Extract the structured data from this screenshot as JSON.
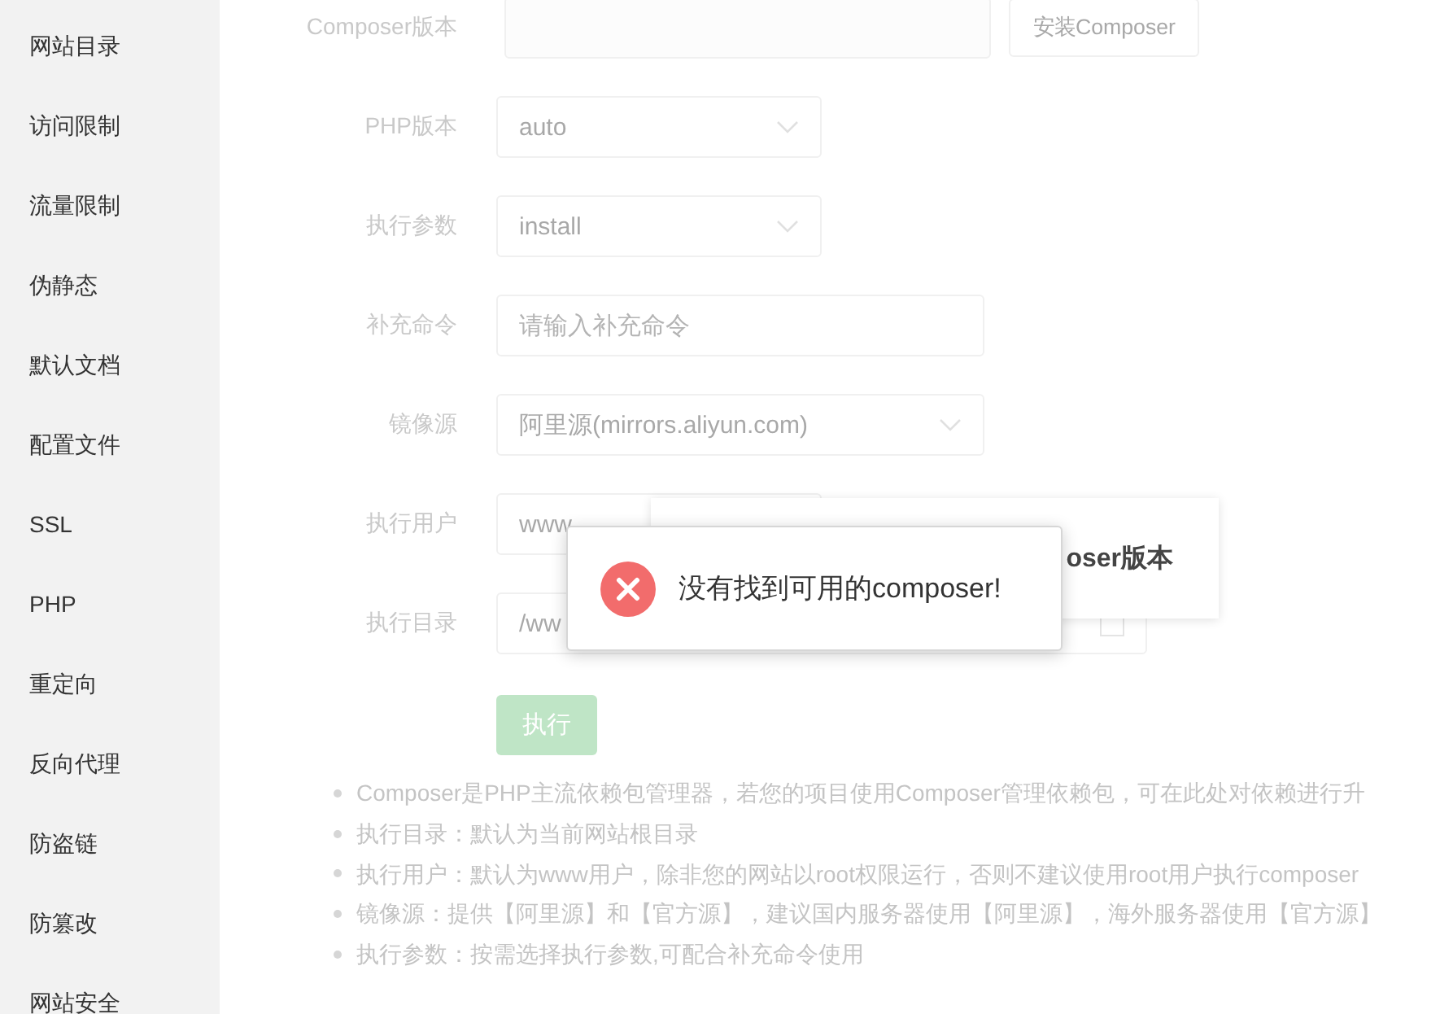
{
  "sidebar": {
    "items": [
      {
        "label": "网站目录"
      },
      {
        "label": "访问限制"
      },
      {
        "label": "流量限制"
      },
      {
        "label": "伪静态"
      },
      {
        "label": "默认文档"
      },
      {
        "label": "配置文件"
      },
      {
        "label": "SSL"
      },
      {
        "label": "PHP"
      },
      {
        "label": "重定向"
      },
      {
        "label": "反向代理"
      },
      {
        "label": "防盗链"
      },
      {
        "label": "防篡改"
      },
      {
        "label": "网站安全"
      }
    ]
  },
  "form": {
    "rows": [
      {
        "kind": "readonly",
        "label": "Composer版本",
        "button": "安装Composer"
      },
      {
        "kind": "select",
        "label": "PHP版本",
        "value": "auto"
      },
      {
        "kind": "select",
        "label": "执行参数",
        "value": "install"
      },
      {
        "kind": "input",
        "label": "补充命令",
        "placeholder": "请输入补充命令"
      },
      {
        "kind": "select-wide",
        "label": "镜像源",
        "value": "阿里源(mirrors.aliyun.com)"
      },
      {
        "kind": "select-covered",
        "label": "执行用户",
        "value": "www"
      },
      {
        "kind": "path",
        "label": "执行目录",
        "value": "/ww"
      }
    ],
    "execute_button": "执行",
    "notes": [
      "Composer是PHP主流依赖包管理器，若您的项目使用Composer管理依赖包，可在此处对依赖进行升",
      "执行目录：默认为当前网站根目录",
      "执行用户：默认为www用户，除非您的网站以root权限运行，否则不建议使用root用户执行composer",
      "镜像源：提供【阿里源】和【官方源】，建议国内服务器使用【阿里源】，海外服务器使用【官方源】",
      "执行参数：按需选择执行参数,可配合补充命令使用"
    ]
  },
  "dialog": {
    "title": "oser版本"
  },
  "toast": {
    "kind": "error",
    "message": "没有找到可用的composer!"
  }
}
